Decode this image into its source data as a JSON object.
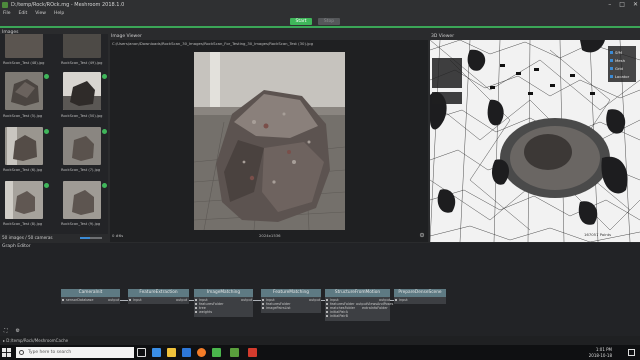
{
  "window": {
    "title": "D:/temp/Rock/ROck.mg - Meshroom 2018.1.0",
    "min": "–",
    "max": "□",
    "close": "✕"
  },
  "menu": [
    "File",
    "Edit",
    "View",
    "Help"
  ],
  "run": {
    "start_label": "Start",
    "stop_label": "Stop"
  },
  "images": {
    "header": "Images",
    "thumbs": [
      {
        "caption": "RockScan_Test (48).jpg"
      },
      {
        "caption": "RockScan_Test (49).jpg"
      },
      {
        "caption": "RockScan_Test (5).jpg"
      },
      {
        "caption": "RockScan_Test (50).jpg"
      },
      {
        "caption": "RockScan_Test (6).jpg"
      },
      {
        "caption": "RockScan_Test (7).jpg"
      },
      {
        "caption": "RockScan_Test (8).jpg"
      },
      {
        "caption": "RockScan_Test (9).jpg"
      }
    ],
    "footer": "50 images / 50 cameras"
  },
  "image_viewer": {
    "header": "Image Viewer",
    "path": "C:/Users/anon/Downloads/RockScan_30_Images/RockScan_For_Testing_30_Images/RockScan_Test (30).jpg",
    "ev": "0 #6s",
    "resolution": "2024x1536"
  },
  "viewer3d": {
    "header": "3D Viewer",
    "legend": [
      "SfM",
      "Mesh",
      "Grid",
      "Locator"
    ],
    "points": "167057 Points"
  },
  "graph": {
    "header": "Graph Editor",
    "nodes": [
      {
        "title": "CameraInit",
        "inputs": [
          "sensorDatabase"
        ],
        "outputs": [
          "output"
        ]
      },
      {
        "title": "FeatureExtraction",
        "inputs": [
          "input"
        ],
        "outputs": [
          "output"
        ]
      },
      {
        "title": "ImageMatching",
        "inputs": [
          "input",
          "featuresFolder",
          "tree",
          "weights"
        ],
        "outputs": [
          "output"
        ]
      },
      {
        "title": "FeatureMatching",
        "inputs": [
          "input",
          "featuresFolder",
          "imagePairsList"
        ],
        "outputs": [
          "output"
        ]
      },
      {
        "title": "StructureFromMotion",
        "inputs": [
          "input",
          "featuresFolder",
          "matchesFolder",
          "initialPairA",
          "initialPairB"
        ],
        "outputs": [
          "output",
          "outputViewsAndPoses",
          "extraInfoFolder"
        ]
      },
      {
        "title": "PrepareDenseScene",
        "inputs": [
          "input"
        ],
        "outputs": [
          "output"
        ]
      }
    ]
  },
  "statusbar": {
    "text": "D:/temp/Rock/MeshroomCache"
  },
  "taskbar": {
    "search_placeholder": "Type here to search",
    "time": "1:01 PM",
    "date": "2018-10-18"
  }
}
